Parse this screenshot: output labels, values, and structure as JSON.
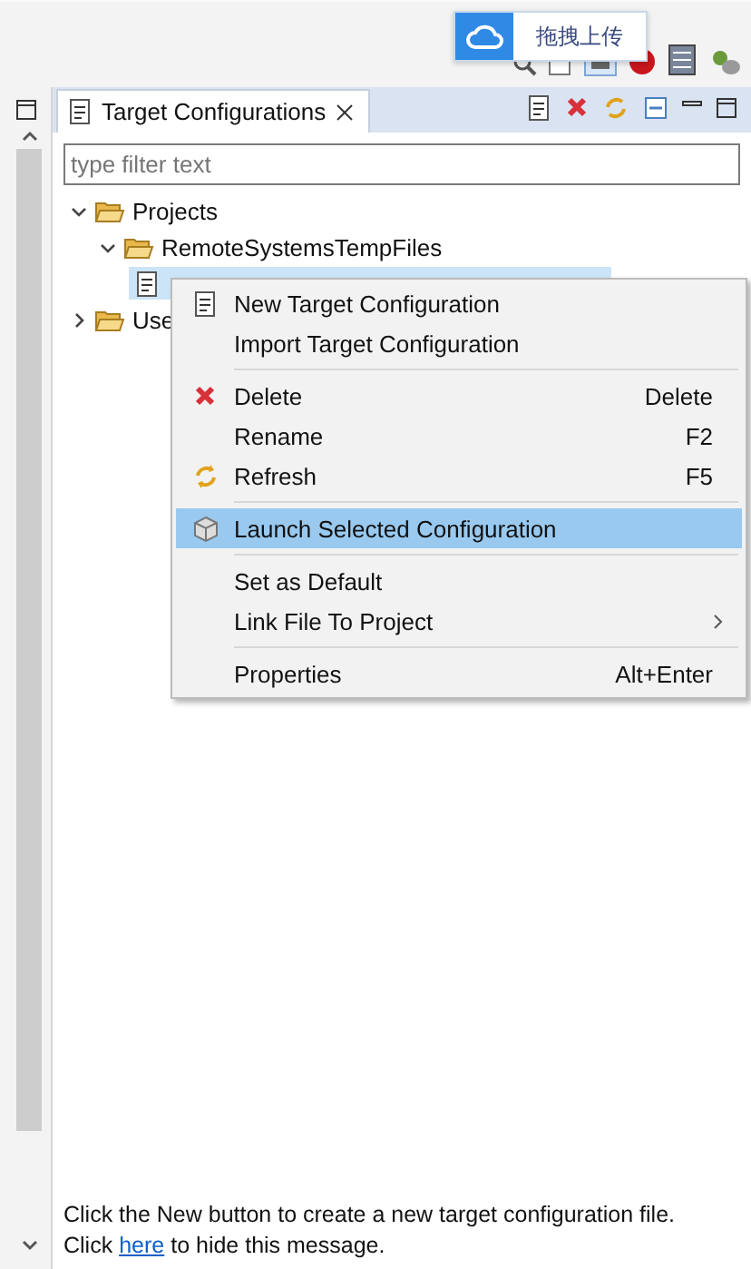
{
  "upload_button": {
    "label": "拖拽上传"
  },
  "view": {
    "tab": {
      "label": "Target Configurations",
      "selected": true
    },
    "filter": {
      "placeholder": "type filter text"
    },
    "tree": [
      {
        "label": "Projects",
        "expanded": true,
        "children": [
          {
            "label": "RemoteSystemsTempFiles",
            "expanded": true,
            "children": [
              {
                "selected": true
              }
            ]
          }
        ]
      },
      {
        "label": "Use",
        "expanded": false
      }
    ],
    "message": {
      "before": "Click the New button to create a new target configuration file.",
      "click": "Click",
      "link": "here",
      "after": "to hide this message."
    }
  },
  "context_menu": {
    "groups": [
      [
        {
          "label": "New Target Configuration",
          "selected": false
        },
        {
          "label": "Import Target Configuration",
          "selected": false
        }
      ],
      [
        {
          "label": "Delete",
          "shortcut": "Delete",
          "selected": false
        },
        {
          "label": "Rename",
          "shortcut": "F2",
          "selected": false
        },
        {
          "label": "Refresh",
          "shortcut": "F5",
          "selected": false
        }
      ],
      [
        {
          "label": "Launch Selected Configuration",
          "selected": true
        }
      ],
      [
        {
          "label": "Set as Default",
          "selected": false
        },
        {
          "label": "Link File To Project",
          "selected": false,
          "submenu": true
        }
      ],
      [
        {
          "label": "Properties",
          "shortcut": "Alt+Enter",
          "selected": false
        }
      ]
    ]
  }
}
